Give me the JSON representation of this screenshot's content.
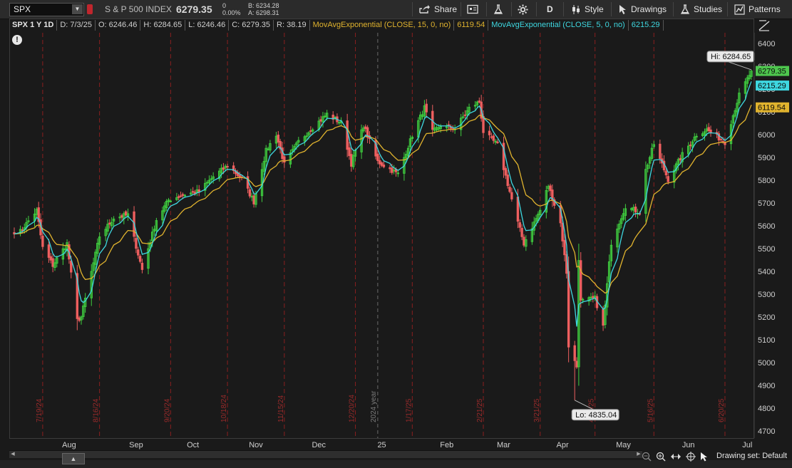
{
  "toolbar": {
    "symbol": "SPX",
    "description": "S & P 500 INDEX",
    "last_price": "6279.35",
    "change_top": "0",
    "change_pct": "0.00%",
    "bid": "B: 6234.28",
    "ask": "A: 6298.31",
    "share_label": "Share",
    "period_label": "D",
    "style_label": "Style",
    "drawings_label": "Drawings",
    "studies_label": "Studies",
    "patterns_label": "Patterns"
  },
  "info_bar": {
    "chart_id": "SPX 1 Y 1D",
    "date": "D: 7/3/25",
    "open": "O: 6246.46",
    "high": "H: 6284.65",
    "low": "L: 6246.46",
    "close": "C: 6279.35",
    "range": "R: 38.19",
    "ema15_label": "MovAvgExponential (CLOSE, 15, 0, no)",
    "ema15_value": "6119.54",
    "ema5_label": "MovAvgExponential (CLOSE, 5, 0, no)",
    "ema5_value": "6215.29"
  },
  "colors": {
    "up_candle": "#3fce3f",
    "down_candle": "#ee5f5f",
    "ema15": "#e0b32e",
    "ema5": "#3ed7e0",
    "price_tag": "#4ec64e",
    "expiration_line": "#8a1f1f",
    "background": "#1a1a1a"
  },
  "chart_data": {
    "type": "candlestick",
    "y_ticks": [
      4700,
      4800,
      4900,
      5000,
      5100,
      5200,
      5300,
      5400,
      5500,
      5600,
      5700,
      5800,
      5900,
      6000,
      6100,
      6200,
      6300,
      6400
    ],
    "ylim": [
      4670,
      6470
    ],
    "x_month_labels": [
      {
        "label": "Aug",
        "date": "2024-08-01"
      },
      {
        "label": "Sep",
        "date": "2024-09-03"
      },
      {
        "label": "Oct",
        "date": "2024-10-01"
      },
      {
        "label": "Nov",
        "date": "2024-11-01"
      },
      {
        "label": "Dec",
        "date": "2024-12-02"
      },
      {
        "label": "25",
        "date": "2025-01-02"
      },
      {
        "label": "Feb",
        "date": "2025-02-03"
      },
      {
        "label": "Mar",
        "date": "2025-03-03"
      },
      {
        "label": "Apr",
        "date": "2025-04-01"
      },
      {
        "label": "May",
        "date": "2025-05-01"
      },
      {
        "label": "Jun",
        "date": "2025-06-02"
      },
      {
        "label": "Jul",
        "date": "2025-07-01"
      }
    ],
    "expiration_lines": [
      {
        "label": "7/19/24",
        "date": "2024-07-19"
      },
      {
        "label": "8/16/24",
        "date": "2024-08-16"
      },
      {
        "label": "9/20/24",
        "date": "2024-09-20"
      },
      {
        "label": "10/18/24",
        "date": "2024-10-18"
      },
      {
        "label": "11/15/24",
        "date": "2024-11-15"
      },
      {
        "label": "12/20/24",
        "date": "2024-12-20"
      },
      {
        "label": "1/17/25",
        "date": "2025-01-17"
      },
      {
        "label": "2/21/25",
        "date": "2025-02-21"
      },
      {
        "label": "3/21/25",
        "date": "2025-03-21"
      },
      {
        "label": "4/17/25",
        "date": "2025-04-17"
      },
      {
        "label": "5/16/25",
        "date": "2025-05-16"
      },
      {
        "label": "6/20/25",
        "date": "2025-06-20"
      }
    ],
    "year_line": {
      "label": "2024 year",
      "date": "2024-12-31"
    },
    "annotations": {
      "high": {
        "label": "Hi: 6284.65",
        "date": "2025-07-03",
        "value": 6284.65
      },
      "low": {
        "label": "Lo: 4835.04",
        "date": "2025-04-07",
        "value": 4835.04
      }
    },
    "price_tags": [
      {
        "value": 6279.35,
        "text": "6279.35",
        "color": "#4ec64e",
        "text_color": "#0a0a0a"
      },
      {
        "value": 6215.29,
        "text": "6215.29",
        "color": "#3ed7e0",
        "text_color": "#0a0a0a"
      },
      {
        "value": 6119.54,
        "text": "6119.54",
        "color": "#e0b32e",
        "text_color": "#0a0a0a"
      }
    ],
    "ema_periods": [
      15,
      5
    ],
    "close_anchors": [
      [
        "2024-07-08",
        5575
      ],
      [
        "2024-07-16",
        5667
      ],
      [
        "2024-07-19",
        5505
      ],
      [
        "2024-07-24",
        5427
      ],
      [
        "2024-07-31",
        5522
      ],
      [
        "2024-08-05",
        5186
      ],
      [
        "2024-08-07",
        5200
      ],
      [
        "2024-08-16",
        5554
      ],
      [
        "2024-08-23",
        5634
      ],
      [
        "2024-08-30",
        5648
      ],
      [
        "2024-09-06",
        5408
      ],
      [
        "2024-09-13",
        5626
      ],
      [
        "2024-09-19",
        5713
      ],
      [
        "2024-09-27",
        5738
      ],
      [
        "2024-10-04",
        5751
      ],
      [
        "2024-10-11",
        5815
      ],
      [
        "2024-10-18",
        5864
      ],
      [
        "2024-10-25",
        5808
      ],
      [
        "2024-10-31",
        5705
      ],
      [
        "2024-11-06",
        5929
      ],
      [
        "2024-11-11",
        6001
      ],
      [
        "2024-11-15",
        5870
      ],
      [
        "2024-11-22",
        5969
      ],
      [
        "2024-11-29",
        6032
      ],
      [
        "2024-12-06",
        6090
      ],
      [
        "2024-12-13",
        6051
      ],
      [
        "2024-12-18",
        5872
      ],
      [
        "2024-12-24",
        6040
      ],
      [
        "2024-12-31",
        5882
      ],
      [
        "2025-01-10",
        5827
      ],
      [
        "2025-01-17",
        5997
      ],
      [
        "2025-01-23",
        6118
      ],
      [
        "2025-01-27",
        6012
      ],
      [
        "2025-01-31",
        6040
      ],
      [
        "2025-02-07",
        6026
      ],
      [
        "2025-02-14",
        6115
      ],
      [
        "2025-02-19",
        6144
      ],
      [
        "2025-02-21",
        6013
      ],
      [
        "2025-02-28",
        5955
      ],
      [
        "2025-03-10",
        5614
      ],
      [
        "2025-03-13",
        5522
      ],
      [
        "2025-03-21",
        5668
      ],
      [
        "2025-03-25",
        5776
      ],
      [
        "2025-03-31",
        5612
      ],
      [
        "2025-04-03",
        5396
      ],
      [
        "2025-04-04",
        5074
      ],
      [
        "2025-04-08",
        4982
      ],
      [
        "2025-04-09",
        5457
      ],
      [
        "2025-04-10",
        5268
      ],
      [
        "2025-04-17",
        5282
      ],
      [
        "2025-04-21",
        5158
      ],
      [
        "2025-04-25",
        5525
      ],
      [
        "2025-05-02",
        5686
      ],
      [
        "2025-05-09",
        5659
      ],
      [
        "2025-05-12",
        5844
      ],
      [
        "2025-05-16",
        5958
      ],
      [
        "2025-05-23",
        5803
      ],
      [
        "2025-05-30",
        5912
      ],
      [
        "2025-06-06",
        6000
      ],
      [
        "2025-06-11",
        6022
      ],
      [
        "2025-06-20",
        5967
      ],
      [
        "2025-06-27",
        6173
      ],
      [
        "2025-07-03",
        6279
      ]
    ],
    "date_range": [
      "2024-07-05",
      "2025-07-03"
    ]
  }
}
